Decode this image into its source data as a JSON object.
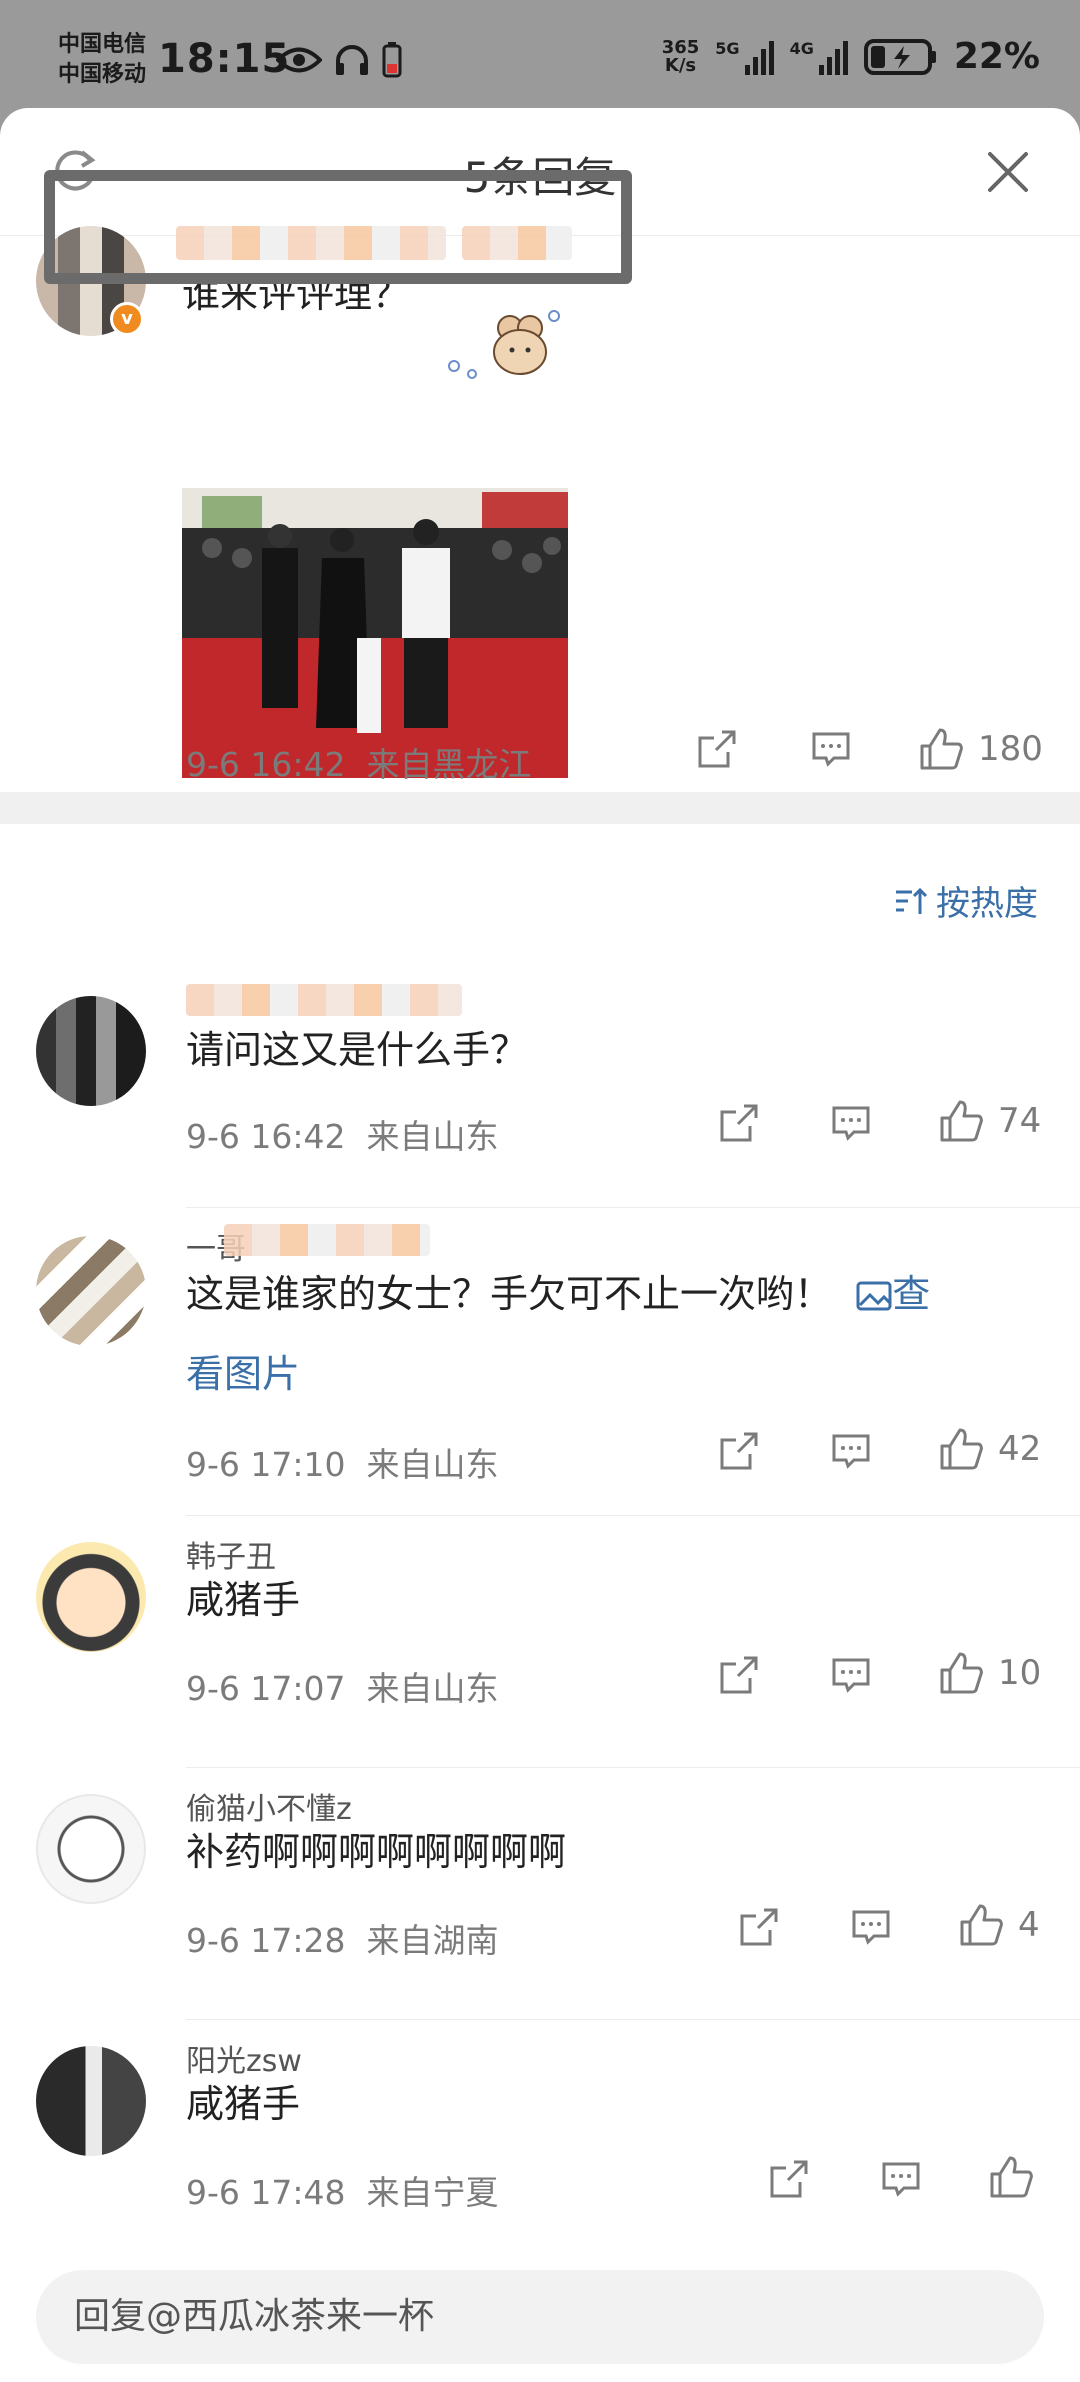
{
  "status_bar": {
    "carrier_1": "中国电信",
    "carrier_2": "中国移动",
    "time": "18:15",
    "net_speed_value": "365",
    "net_speed_unit": "K/s",
    "signal_1": "5G",
    "signal_2": "4G",
    "battery": "22%"
  },
  "sheet": {
    "title": "5条回复",
    "icons": {
      "refresh": "refresh-icon",
      "close": "close-icon"
    }
  },
  "post": {
    "text": "谁来评评理？",
    "date": "9-6 16:42",
    "location": "来自黑龙江",
    "likes": "180"
  },
  "sort": {
    "label": "按热度"
  },
  "replies": [
    {
      "username": "",
      "text": "请问这又是什么手？",
      "date": "9-6 16:42",
      "location": "来自山东",
      "likes": "74"
    },
    {
      "username": "一哥",
      "text": "这是谁家的女士？手欠可不止一次哟！",
      "link_1": "查",
      "link_2": "看图片",
      "date": "9-6 17:10",
      "location": "来自山东",
      "likes": "42"
    },
    {
      "username": "韩子丑",
      "text": "咸猪手",
      "date": "9-6 17:07",
      "location": "来自山东",
      "likes": "10"
    },
    {
      "username": "偷猫小不懂z",
      "text": "补药啊啊啊啊啊啊啊啊",
      "date": "9-6 17:28",
      "location": "来自湖南",
      "likes": "4"
    },
    {
      "username": "阳光zsw",
      "text": "咸猪手",
      "date": "9-6 17:48",
      "location": "来自宁夏",
      "likes": ""
    }
  ],
  "reply_input": {
    "placeholder": "回复@西瓜冰茶来一杯"
  },
  "colors": {
    "accent": "#3b6fa8",
    "badge": "#f08b1f",
    "meta": "#7b7b7b"
  }
}
